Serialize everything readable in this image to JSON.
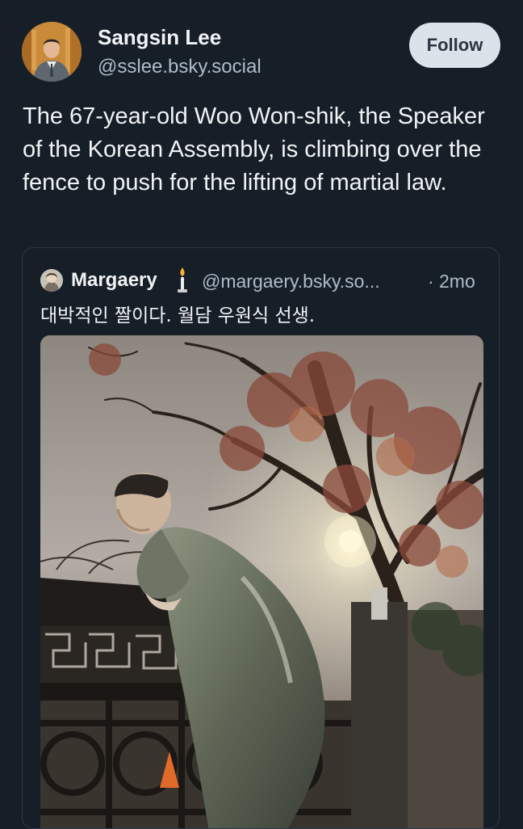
{
  "post": {
    "author": {
      "display_name": "Sangsin Lee",
      "handle": "@sslee.bsky.social"
    },
    "follow_label": "Follow",
    "text": "The 67-year-old Woo Won-shik, the Speaker of the Korean Assembly, is climbing over the fence to push for the lifting of martial law."
  },
  "quote": {
    "author": {
      "display_name": "Margaery",
      "handle": "@margaery.bsky.so...",
      "emoji_icon": "candle-icon"
    },
    "separator": "·",
    "time": "2mo",
    "text": "대박적인 짤이다. 월담 우원식 선생."
  },
  "colors": {
    "background": "#161e27",
    "primary_text": "#f1f3f5",
    "secondary_text": "#aebbc9",
    "follow_button_bg": "#dce2ea",
    "follow_button_text": "#2b3440",
    "card_border": "#2e3a48"
  }
}
